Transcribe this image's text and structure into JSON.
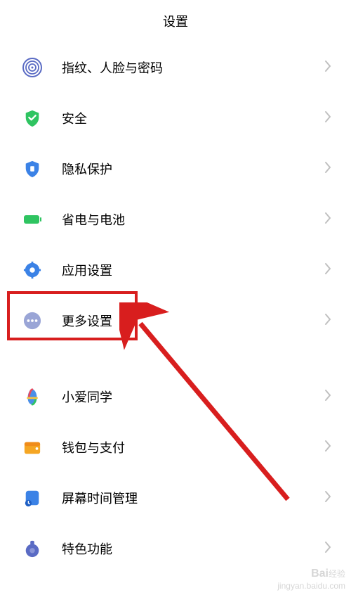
{
  "header": {
    "title": "设置"
  },
  "items": [
    {
      "label": "指纹、人脸与密码",
      "icon": "fingerprint-icon"
    },
    {
      "label": "安全",
      "icon": "shield-check-icon"
    },
    {
      "label": "隐私保护",
      "icon": "shield-icon"
    },
    {
      "label": "省电与电池",
      "icon": "battery-icon"
    },
    {
      "label": "应用设置",
      "icon": "gear-icon"
    },
    {
      "label": "更多设置",
      "icon": "more-icon"
    }
  ],
  "items2": [
    {
      "label": "小爱同学",
      "icon": "xiaoai-icon"
    },
    {
      "label": "钱包与支付",
      "icon": "wallet-icon"
    },
    {
      "label": "屏幕时间管理",
      "icon": "screen-time-icon"
    },
    {
      "label": "特色功能",
      "icon": "special-icon"
    }
  ],
  "watermark": {
    "brand": "Bai",
    "sub": "经验",
    "url": "jingyan.baidu.com"
  }
}
